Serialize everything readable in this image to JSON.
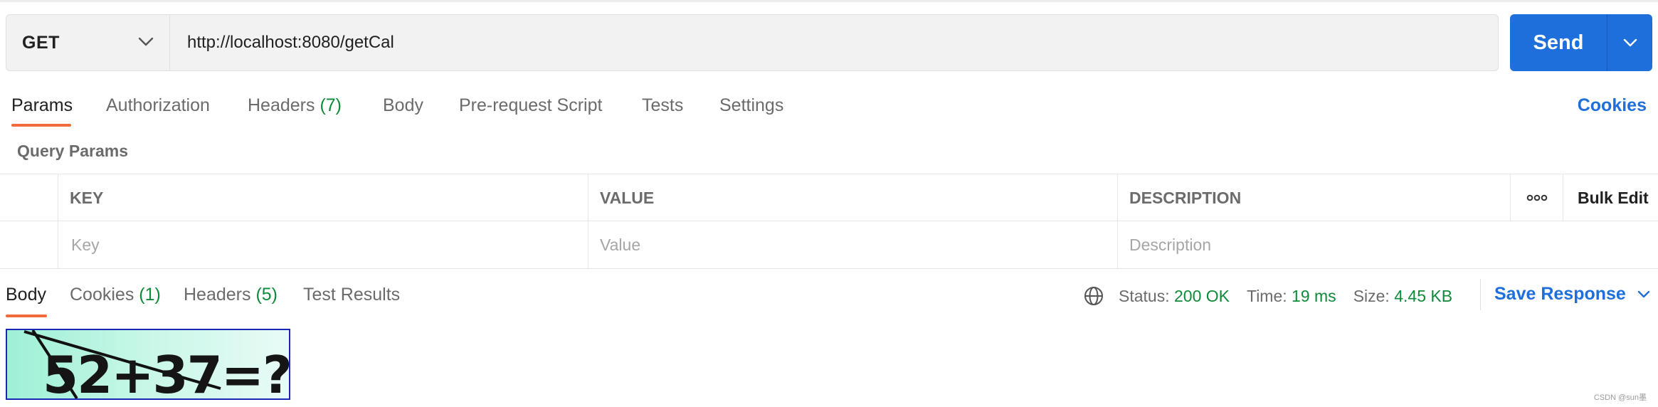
{
  "request": {
    "method": "GET",
    "url": "http://localhost:8080/getCal",
    "send_label": "Send"
  },
  "request_tabs": [
    {
      "label": "Params",
      "active": true
    },
    {
      "label": "Authorization"
    },
    {
      "label": "Headers",
      "count": "(7)"
    },
    {
      "label": "Body"
    },
    {
      "label": "Pre-request Script"
    },
    {
      "label": "Tests"
    },
    {
      "label": "Settings"
    }
  ],
  "cookies_link": "Cookies",
  "query_params": {
    "title": "Query Params",
    "columns": {
      "key": "KEY",
      "value": "VALUE",
      "description": "DESCRIPTION",
      "bulk_edit": "Bulk Edit",
      "more": "ooo"
    },
    "placeholders": {
      "key": "Key",
      "value": "Value",
      "description": "Description"
    }
  },
  "response_tabs": [
    {
      "label": "Body",
      "active": true
    },
    {
      "label": "Cookies",
      "count": "(1)"
    },
    {
      "label": "Headers",
      "count": "(5)"
    },
    {
      "label": "Test Results"
    }
  ],
  "response_status": {
    "status_label": "Status:",
    "status_value": "200 OK",
    "time_label": "Time:",
    "time_value": "19 ms",
    "size_label": "Size:",
    "size_value": "4.45 KB"
  },
  "save_response": "Save Response",
  "captcha_text": "52+37=?",
  "watermark": "CSDN @sun墨",
  "colors": {
    "accent": "#1e6fdc",
    "active_tab": "#f26b3a",
    "count_green": "#0f8a3a"
  }
}
